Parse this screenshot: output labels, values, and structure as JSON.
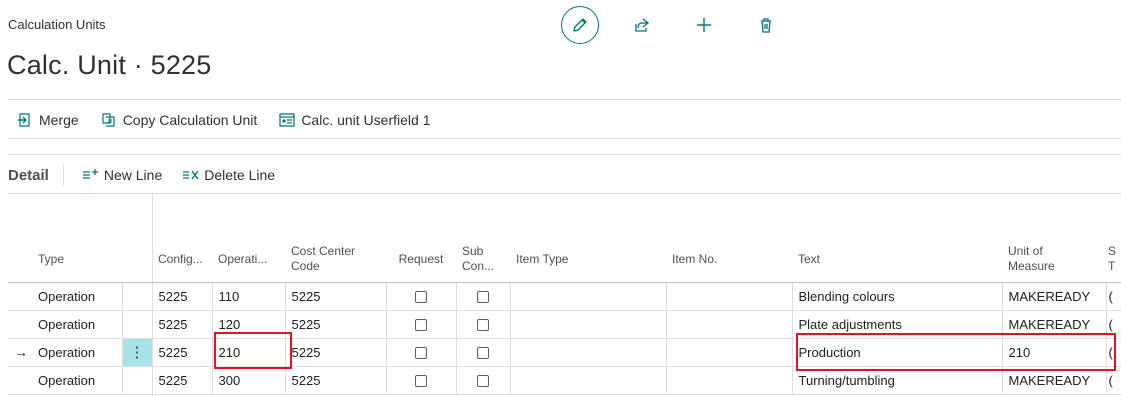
{
  "breadcrumb": "Calculation Units",
  "page_title": "Calc. Unit · 5225",
  "top_actions": [
    {
      "name": "edit",
      "icon": "pencil-icon"
    },
    {
      "name": "share",
      "icon": "share-icon"
    },
    {
      "name": "new",
      "icon": "plus-icon"
    },
    {
      "name": "delete",
      "icon": "trash-icon"
    }
  ],
  "actionbar": {
    "merge": "Merge",
    "copy": "Copy Calculation Unit",
    "userfield": "Calc. unit Userfield 1"
  },
  "detail": {
    "title": "Detail",
    "new_line": "New Line",
    "delete_line": "Delete Line"
  },
  "columns": {
    "type": "Type",
    "config": "Config...",
    "operation": "Operati...",
    "cost_center_1": "Cost Center",
    "cost_center_2": "Code",
    "request": "Request",
    "subcon_1": "Sub",
    "subcon_2": "Con...",
    "item_type": "Item Type",
    "item_no": "Item No.",
    "text": "Text",
    "uom_1": "Unit of",
    "uom_2": "Measure",
    "extra_1": "S",
    "extra_2": "T"
  },
  "rows": [
    {
      "type": "Operation",
      "config": "5225",
      "operation": "110",
      "cost_center": "5225",
      "text": "Blending colours",
      "uom": "MAKEREADY",
      "extra": "("
    },
    {
      "type": "Operation",
      "config": "5225",
      "operation": "120",
      "cost_center": "5225",
      "text": "Plate adjustments",
      "uom": "MAKEREADY",
      "extra": "("
    },
    {
      "type": "Operation",
      "config": "5225",
      "operation": "210",
      "cost_center": "5225",
      "text": "Production",
      "uom": "210",
      "extra": "("
    },
    {
      "type": "Operation",
      "config": "5225",
      "operation": "300",
      "cost_center": "5225",
      "text": "Turning/tumbling",
      "uom": "MAKEREADY",
      "extra": "("
    }
  ],
  "colors": {
    "accent": "#00767a",
    "highlight": "#e81123",
    "selected_cell": "#a6e3e9"
  }
}
